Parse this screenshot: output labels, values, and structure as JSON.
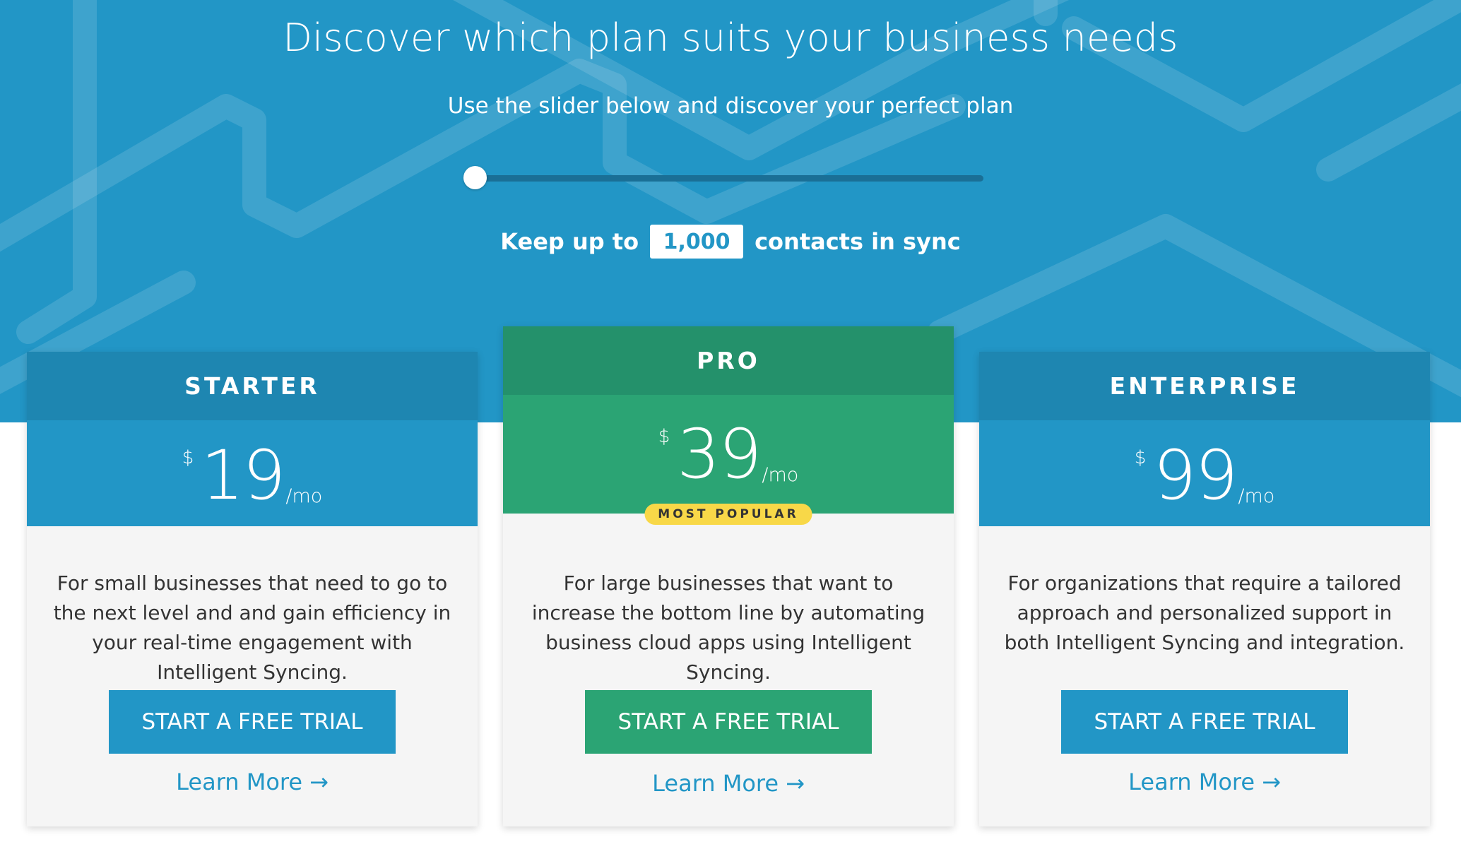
{
  "hero": {
    "title": "Discover which plan suits your business needs",
    "subtitle": "Use the slider below and discover your perfect plan",
    "slider_value": 0,
    "contacts_prefix": "Keep up to",
    "contacts_value": "1,000",
    "contacts_suffix": "contacts in sync"
  },
  "colors": {
    "hero_blue": "#2296c6",
    "starter_header": "#1e86b1",
    "pro_header": "#24916b",
    "pro_green": "#2ba474",
    "badge_yellow": "#f8d848",
    "card_bg": "#f5f5f5"
  },
  "plans": [
    {
      "name": "STARTER",
      "currency": "$",
      "price": "19",
      "period": "/mo",
      "description": "For small businesses that need to go to the next level and and gain efficiency in your real-time engagement with Intelligent Syncing.",
      "cta": "START A FREE TRIAL",
      "learn_more": "Learn More",
      "arrow": "→"
    },
    {
      "name": "PRO",
      "currency": "$",
      "price": "39",
      "period": "/mo",
      "badge": "MOST POPULAR",
      "description": "For large businesses that want to increase the bottom line by automating business cloud apps using Intelligent Syncing.",
      "cta": "START A FREE TRIAL",
      "learn_more": "Learn More",
      "arrow": "→"
    },
    {
      "name": "ENTERPRISE",
      "currency": "$",
      "price": "99",
      "period": "/mo",
      "description": "For organizations that require a tailored approach and personalized support in both Intelligent Syncing and integration.",
      "cta": "START A FREE TRIAL",
      "learn_more": "Learn More",
      "arrow": "→"
    }
  ]
}
